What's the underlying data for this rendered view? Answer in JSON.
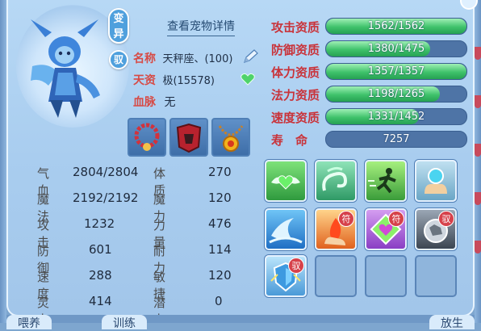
{
  "header": {
    "mutant_tag": "变异",
    "ride_tag": "驭",
    "detail_link": "查看宠物详情"
  },
  "info": {
    "name_label": "名称",
    "name_value": "天秤座、(100)",
    "aptitude_label": "天资",
    "aptitude_value": "极(15578)",
    "bloodline_label": "血脉",
    "bloodline_value": "无"
  },
  "equipment": [
    {
      "name": "red-bead-necklace"
    },
    {
      "name": "red-dragon-armor"
    },
    {
      "name": "golden-sun-necklace"
    }
  ],
  "stats": {
    "hp_label": "气血",
    "hp_value": "2804/2804",
    "mp_label": "魔法",
    "mp_value": "2192/2192",
    "atk_label": "攻击",
    "atk_value": "1232",
    "def_label": "防御",
    "def_value": "601",
    "spd_label": "速度",
    "spd_value": "288",
    "spi_label": "灵力",
    "spi_value": "414",
    "con_label": "体质",
    "con_value": "270",
    "mag_label": "魔力",
    "mag_value": "120",
    "str_label": "力量",
    "str_value": "476",
    "end_label": "耐力",
    "end_value": "114",
    "agi_label": "敏捷",
    "agi_value": "120",
    "pot_label": "潜力",
    "pot_value": "0"
  },
  "aptitudes": [
    {
      "label": "攻击资质",
      "text": "1562/1562",
      "fill": 1.0
    },
    {
      "label": "防御资质",
      "text": "1380/1475",
      "fill": 0.74
    },
    {
      "label": "体力资质",
      "text": "1357/1357",
      "fill": 1.0
    },
    {
      "label": "法力资质",
      "text": "1198/1265",
      "fill": 0.81
    },
    {
      "label": "速度资质",
      "text": "1331/1452",
      "fill": 0.66
    },
    {
      "label": "寿　命",
      "text": "7257",
      "fill": 0
    }
  ],
  "skill_badges": {
    "fu": "符",
    "yu": "驭"
  },
  "bottom_tabs": {
    "left": "喂养",
    "mid": "训练",
    "right": "放生"
  }
}
